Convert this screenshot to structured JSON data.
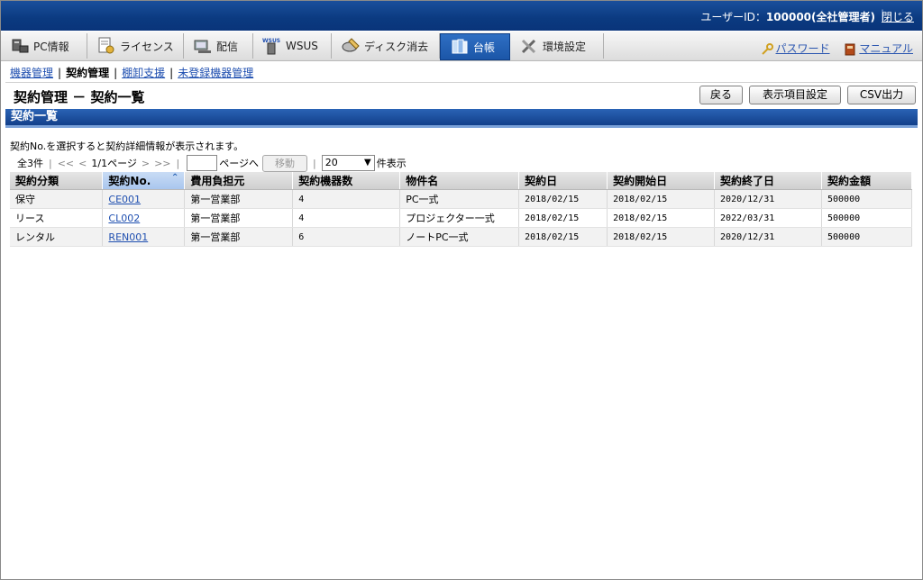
{
  "header": {
    "user_prefix": "ユーザーID：",
    "user_id": "100000(全社管理者)",
    "close_label": "閉じる",
    "colors": {
      "bar": "#0b3a80",
      "active_tab": "#1b56a8"
    }
  },
  "tabs": [
    {
      "label": "PC情報",
      "icon": "pc-icon"
    },
    {
      "label": "ライセンス",
      "icon": "license-icon"
    },
    {
      "label": "配信",
      "icon": "delivery-icon"
    },
    {
      "label": "WSUS",
      "icon": "wsus-icon"
    },
    {
      "label": "ディスク消去",
      "icon": "disk-erase-icon"
    },
    {
      "label": "台帳",
      "icon": "ledger-icon",
      "active": true
    },
    {
      "label": "環境設定",
      "icon": "tools-icon"
    }
  ],
  "right_links": {
    "password": "パスワード",
    "manual": "マニュアル"
  },
  "subnav": {
    "equipment": "機器管理",
    "contract": "契約管理",
    "inventory": "棚卸支援",
    "unregistered": "未登録機器管理"
  },
  "page": {
    "title": "契約管理 － 契約一覧",
    "back_button": "戻る",
    "display_settings_button": "表示項目設定",
    "csv_button": "CSV出力",
    "section_title": "契約一覧",
    "note": "契約No.を選択すると契約詳細情報が表示されます。"
  },
  "pager": {
    "total": "全3件",
    "first": "<<",
    "prev": "<",
    "page_info": "1/1ページ",
    "next": ">",
    "last": ">>",
    "page_input": "",
    "page_suffix": "ページへ",
    "move_button": "移動",
    "per_page": "20",
    "per_page_suffix": "件表示"
  },
  "table": {
    "columns": [
      "契約分類",
      "契約No.",
      "費用負担元",
      "契約機器数",
      "物件名",
      "契約日",
      "契約開始日",
      "契約終了日",
      "契約金額"
    ],
    "rows": [
      [
        "保守",
        "CE001",
        "第一営業部",
        "4",
        "PC一式",
        "2018/02/15",
        "2018/02/15",
        "2020/12/31",
        "500000"
      ],
      [
        "リース",
        "CL002",
        "第一営業部",
        "4",
        "プロジェクター一式",
        "2018/02/15",
        "2018/02/15",
        "2022/03/31",
        "500000"
      ],
      [
        "レンタル",
        "REN001",
        "第一営業部",
        "6",
        "ノートPC一式",
        "2018/02/15",
        "2018/02/15",
        "2020/12/31",
        "500000"
      ]
    ]
  }
}
